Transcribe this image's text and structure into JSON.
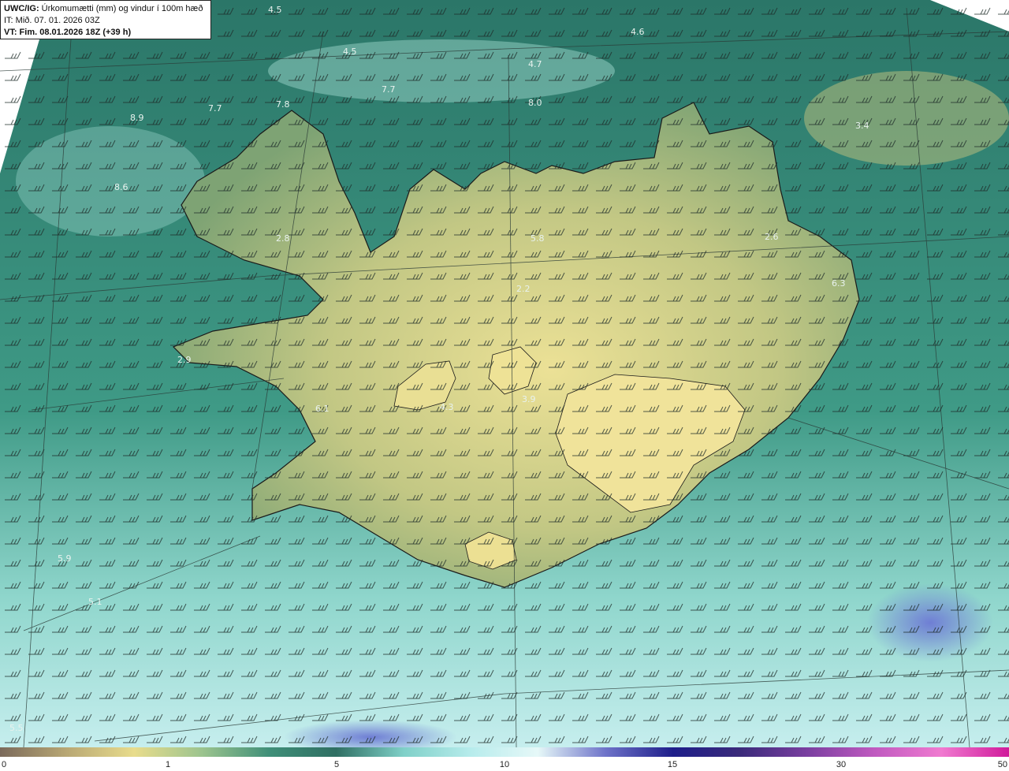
{
  "header": {
    "prefix": "UWC/IG:",
    "title": " Úrkomumætti (mm) og vindur í 100m hæð",
    "it": "IT: Mið. 07. 01. 2026 03Z",
    "vt": "VT: Fim. 08.01.2026 18Z (+39 h)"
  },
  "value_labels": [
    "4.5",
    "4.6",
    "4.5",
    "4.7",
    "7.7",
    "7.7",
    "7.8",
    "8.0",
    "8.9",
    "3.4",
    "8.6",
    "2.8",
    "5.8",
    "2.6",
    "6.3",
    "2.2",
    "2.9",
    "6.1",
    "4.3",
    "3.9",
    "5.9",
    "5.1",
    "5.5"
  ],
  "colorbar": {
    "ticks": [
      "0",
      "1",
      "5",
      "10",
      "15",
      "30",
      "50"
    ],
    "colors": [
      "#7b6a5b",
      "#b9a874",
      "#e8dc8c",
      "#9cc48e",
      "#3f8f78",
      "#2f6f63",
      "#7fd0c8",
      "#b7ecec",
      "#e6f8f8",
      "#6e73c9",
      "#1e1e8a",
      "#3a2a7a",
      "#7a3fa0",
      "#c05ac0",
      "#f07ad0",
      "#d01a9a"
    ]
  },
  "colors": {
    "ocean": "#2e7a6a",
    "land": "#b5c27e",
    "land_high": "#e4dc8c",
    "coast_line": "#1a1a1a",
    "grid_line": "#333333"
  }
}
